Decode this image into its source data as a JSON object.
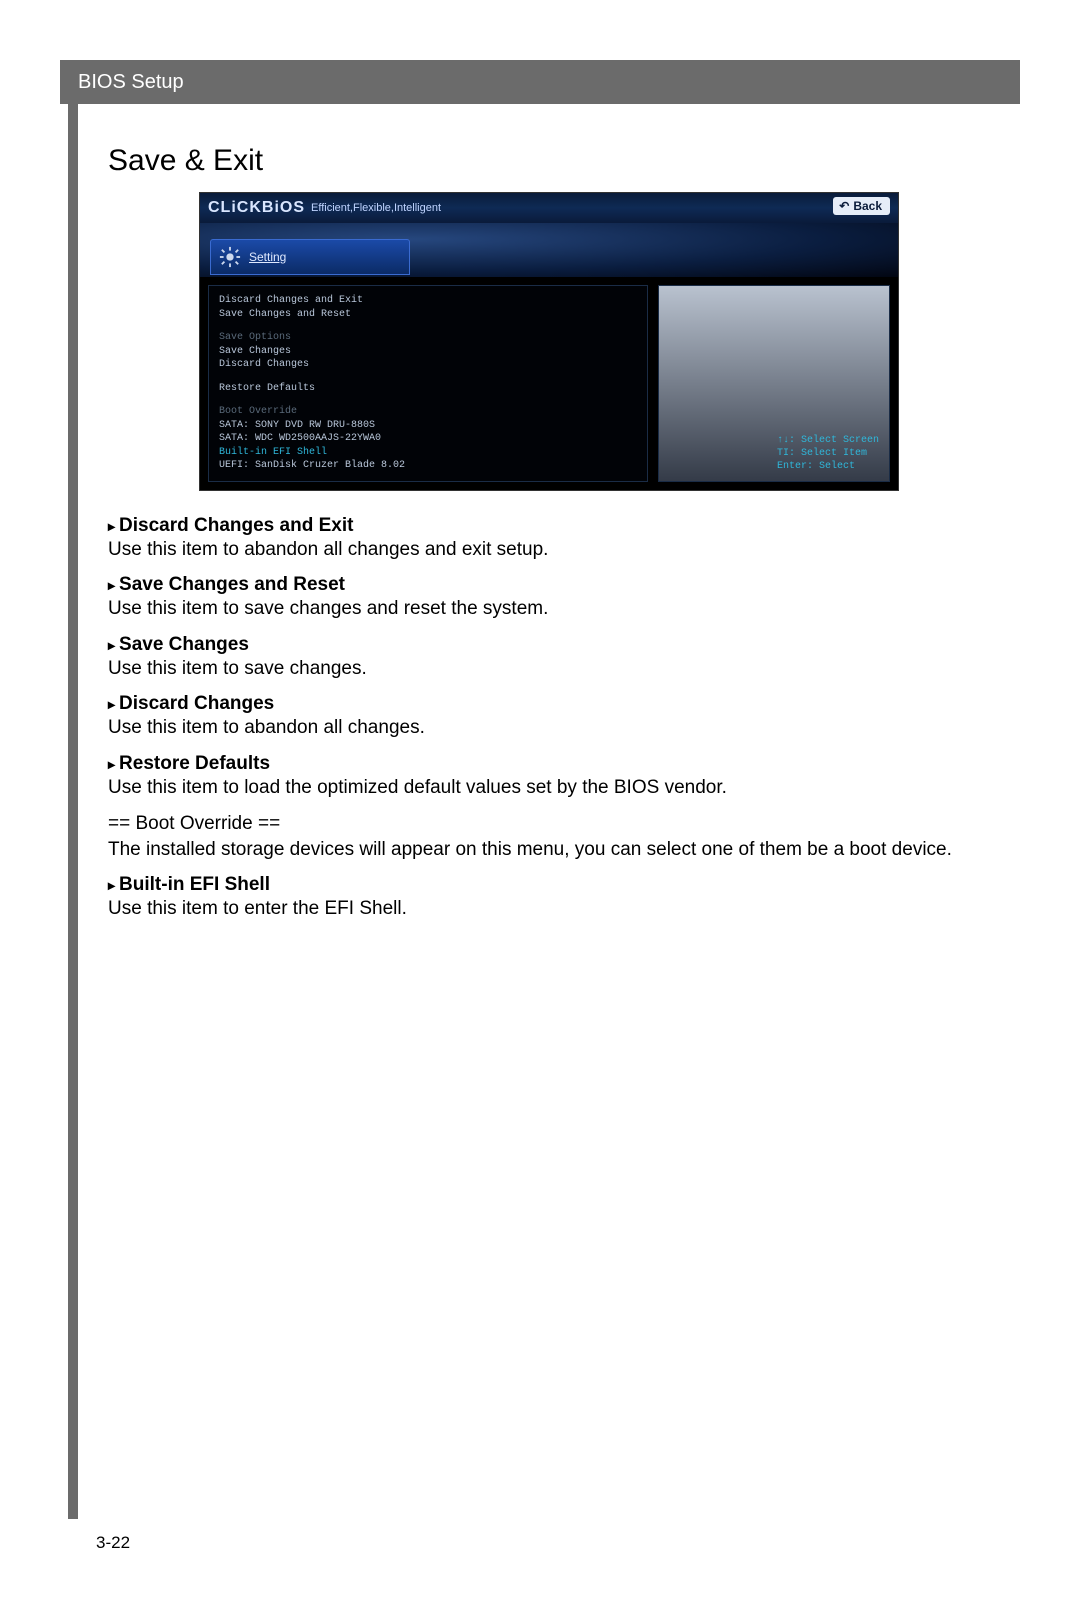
{
  "header": {
    "title": "BIOS Setup"
  },
  "section": {
    "title": "Save & Exit"
  },
  "bios": {
    "logo": "CLiCKBiOS",
    "tagline": "Efficient,Flexible,Intelligent",
    "back": "Back",
    "tab": "Setting",
    "menu": {
      "group1": [
        "Discard Changes and Exit",
        "Save Changes and Reset"
      ],
      "save_options_label": "Save Options",
      "group2": [
        "Save Changes",
        "Discard Changes"
      ],
      "group3": [
        "Restore Defaults"
      ],
      "boot_override_label": "Boot Override",
      "boot_items": [
        "SATA: SONY    DVD RW DRU-880S",
        "SATA: WDC WD2500AAJS-22YWA0",
        "Built-in EFI Shell",
        "UEFI: SanDisk Cruzer Blade 8.02"
      ]
    },
    "hints": {
      "l1": "↑↓: Select Screen",
      "l2": "TI: Select Item",
      "l3": "Enter: Select"
    }
  },
  "descriptions": [
    {
      "head": "Discard Changes and Exit",
      "text": "Use this item to abandon all changes and exit setup."
    },
    {
      "head": "Save Changes and Reset",
      "text": "Use this item to save changes and reset the system."
    },
    {
      "head": "Save Changes",
      "text": "Use this item to save changes."
    },
    {
      "head": "Discard Changes",
      "text": "Use this item to abandon all changes."
    },
    {
      "head": "Restore Defaults",
      "text": "Use this item to load the optimized default values set by the BIOS vendor."
    }
  ],
  "boot_override": {
    "head": "== Boot Override ==",
    "text": "The installed storage devices will appear on this menu, you can select one of them be a boot device."
  },
  "efi": {
    "head": "Built-in EFI Shell",
    "text": "Use this item to enter the EFI Shell."
  },
  "page_number": "3-22"
}
